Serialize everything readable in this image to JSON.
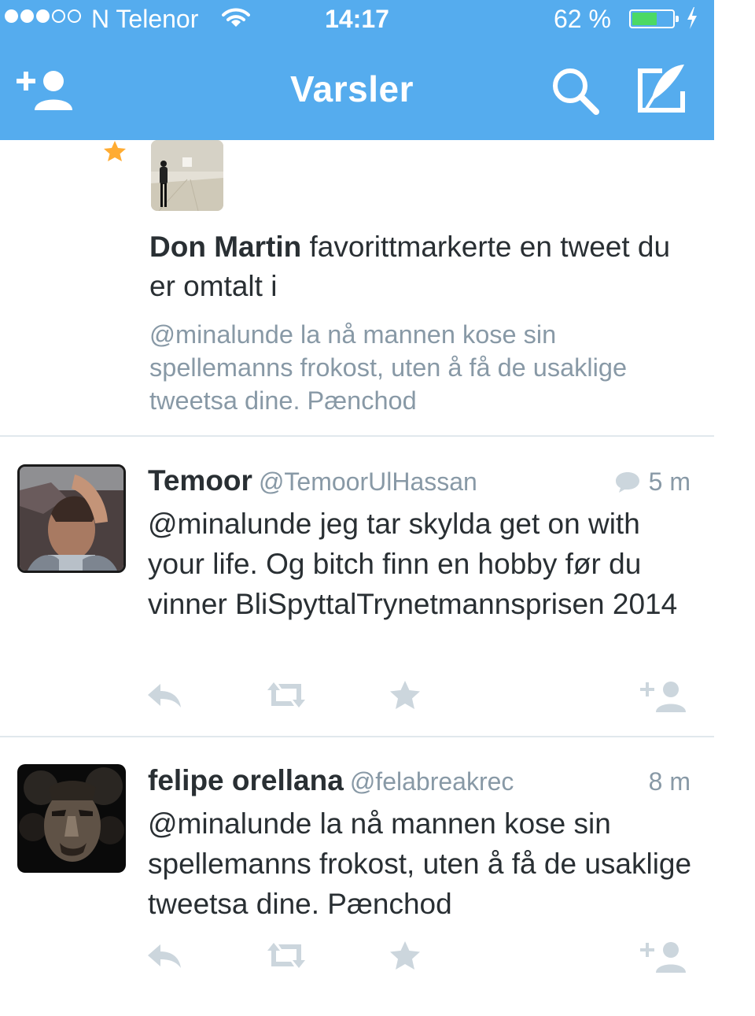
{
  "status_bar": {
    "carrier": "N Telenor",
    "time": "14:17",
    "battery_percent": "62 %",
    "battery_level": 0.62,
    "signal_bars": 3,
    "icons": [
      "signal-dots-icon",
      "wifi-icon",
      "battery-icon",
      "charging-bolt-icon"
    ]
  },
  "nav": {
    "title": "Varsler",
    "icons": [
      "add-user-icon",
      "search-icon",
      "compose-icon"
    ]
  },
  "colors": {
    "brand_blue": "#55acee",
    "muted_text": "#8899a6",
    "favorite_star": "#ffac33",
    "battery_green": "#4cd964"
  },
  "notification": {
    "icon": "star-icon",
    "actor": "Don Martin",
    "action": " favorittmarkerte en tweet du er omtalt i",
    "quoted_text": "@minalunde la nå mannen kose sin spellemanns frokost, uten å få de usaklige tweetsa dine. Pænchod"
  },
  "tweets": [
    {
      "name": "Temoor",
      "handle": "@TemoorUlHassan",
      "time": "5 m",
      "has_reply_icon": true,
      "text": "@minalunde jeg tar skylda get on with your life. Og bitch finn en hobby før du vinner BliSpyttalTrynetmannsprisen 2014"
    },
    {
      "name": "felipe orellana",
      "handle": "@felabreakrec",
      "time": "8 m",
      "has_reply_icon": false,
      "text": "@minalunde la nå mannen kose sin spellemanns frokost, uten å få de usaklige tweetsa dine. Pænchod"
    }
  ],
  "tweet_actions": [
    "reply-icon",
    "retweet-icon",
    "favorite-icon",
    "follow-icon"
  ]
}
